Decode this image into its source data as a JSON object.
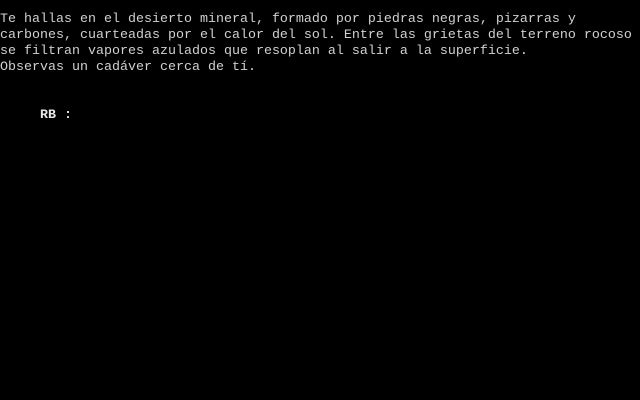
{
  "narration": {
    "lines": [
      "Te hallas en el desierto mineral, formado por piedras negras, pizarras y",
      "carbones, cuarteadas por el calor del sol. Entre las grietas del terreno rocoso",
      "se filtran vapores azulados que resoplan al salir a la superficie.",
      "Observas un cadáver cerca de tí."
    ]
  },
  "prompt": {
    "label": "RB :",
    "input_value": ""
  },
  "colors": {
    "background": "#000000",
    "text": "#d0d0d0"
  }
}
